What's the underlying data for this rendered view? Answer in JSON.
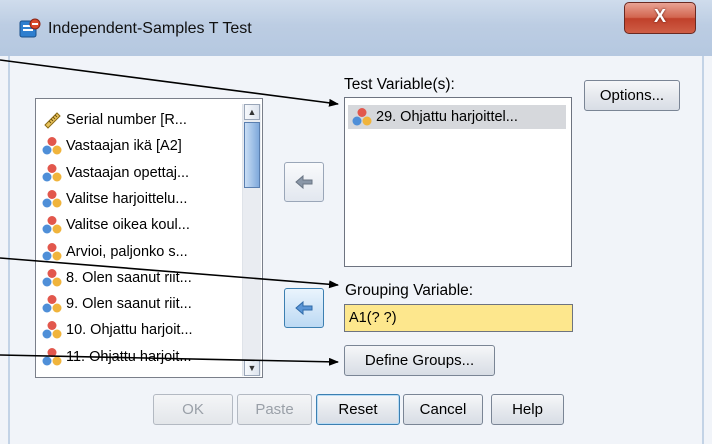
{
  "window": {
    "title": "Independent-Samples T Test",
    "close_label": "X"
  },
  "variable_list": {
    "items": [
      {
        "label": "Serial number [R...",
        "icon": "ruler-icon"
      },
      {
        "label": "Vastaajan ikä [A2]",
        "icon": "nominal-variable-icon"
      },
      {
        "label": "Vastaajan opettaj...",
        "icon": "nominal-variable-icon"
      },
      {
        "label": "Valitse harjoittelu...",
        "icon": "nominal-variable-icon"
      },
      {
        "label": "Valitse oikea koul...",
        "icon": "nominal-variable-icon"
      },
      {
        "label": "Arvioi, paljonko s...",
        "icon": "nominal-variable-icon"
      },
      {
        "label": "8. Olen saanut riit...",
        "icon": "nominal-variable-icon"
      },
      {
        "label": "9. Olen saanut riit...",
        "icon": "nominal-variable-icon"
      },
      {
        "label": "10. Ohjattu harjoit...",
        "icon": "nominal-variable-icon"
      },
      {
        "label": "11. Ohjattu harjoit...",
        "icon": "nominal-variable-icon"
      }
    ]
  },
  "test_variables": {
    "label": "Test Variable(s):",
    "items": [
      {
        "label": "29. Ohjattu harjoittel...",
        "icon": "nominal-variable-icon"
      }
    ]
  },
  "grouping": {
    "label": "Grouping Variable:",
    "value": "A1(? ?)",
    "define_groups_label": "Define Groups..."
  },
  "buttons": {
    "options": "Options...",
    "ok": "OK",
    "paste": "Paste",
    "reset": "Reset",
    "cancel": "Cancel",
    "help": "Help"
  },
  "colors": {
    "grouping_field_bg": "#fde78d",
    "close_button": "#c9452e",
    "selected_row": "#d6d8dc"
  }
}
